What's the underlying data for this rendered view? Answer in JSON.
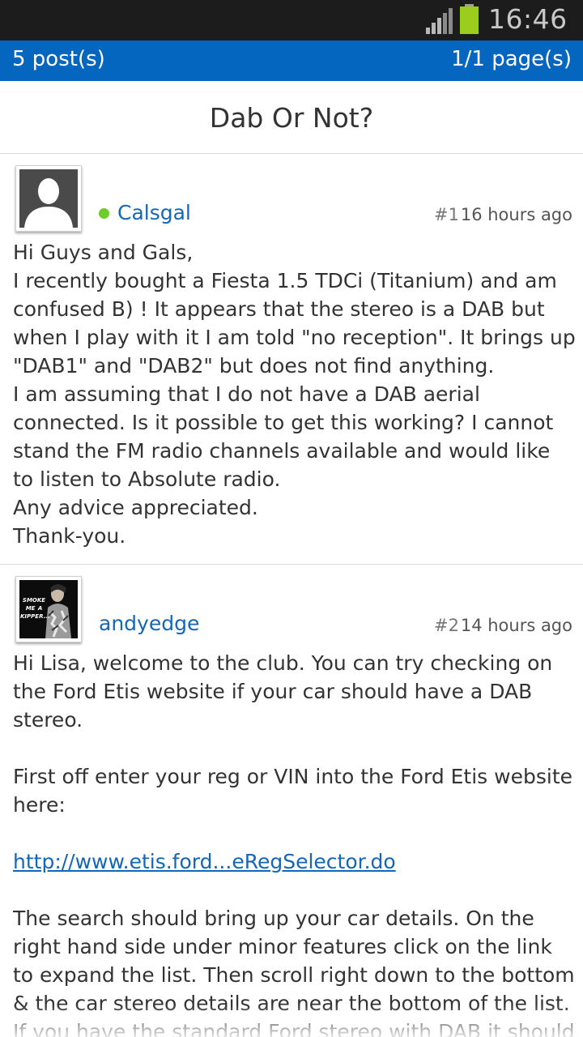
{
  "status_bar": {
    "time": "16:46"
  },
  "header": {
    "post_count": "5 post(s)",
    "page_count": "1/1 page(s)"
  },
  "thread": {
    "title": "Dab Or Not?"
  },
  "posts": [
    {
      "username": "Calsgal",
      "number": "#1",
      "time": "16 hours ago",
      "avatar": "default-user-icon",
      "lines": [
        "Hi Guys and Gals,",
        "I recently bought a Fiesta 1.5 TDCi (Titanium) and am",
        "confused B) ! It appears that the stereo is a DAB but",
        "when I play with it I am told \"no reception\". It brings up",
        "\"DAB1\" and \"DAB2\" but does not find anything.",
        "I am assuming that I do not have a DAB aerial",
        "connected. Is it possible to get this working? I cannot",
        "stand the FM radio channels available and would like",
        "to listen to Absolute radio.",
        "Any advice appreciated.",
        "Thank-you."
      ]
    },
    {
      "username": "andyedge",
      "number": "#2",
      "time": "14 hours ago",
      "avatar_caption": "SMOKE ME A KIPPER...",
      "lines_a": [
        "Hi Lisa, welcome to the club. You can try checking on",
        "the Ford Etis website if your car should have a DAB",
        "stereo."
      ],
      "lines_b": [
        "First off enter your reg or VIN into the Ford Etis website",
        "here:"
      ],
      "link": "http://www.etis.ford...eRegSelector.do",
      "lines_c": [
        "The search should bring up your car details. On the",
        "right hand side under minor features click on the link",
        "to expand the list. Then scroll right down to the bottom",
        "& the car stereo details are near the bottom of the list.",
        "If you have the standard Ford stereo with DAB it should"
      ]
    }
  ]
}
